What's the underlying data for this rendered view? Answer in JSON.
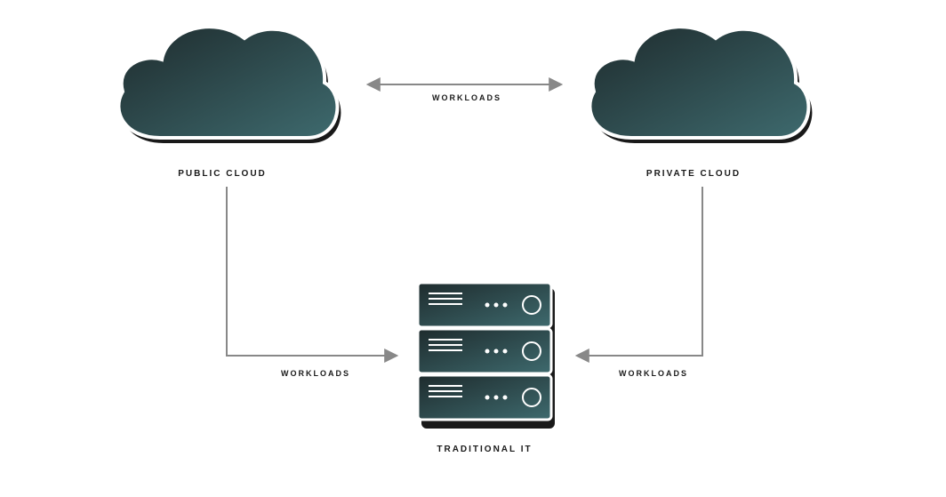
{
  "nodes": {
    "public_cloud": {
      "label": "PUBLIC CLOUD"
    },
    "private_cloud": {
      "label": "PRIVATE CLOUD"
    },
    "traditional_it": {
      "label": "TRADITIONAL IT"
    }
  },
  "arrows": {
    "top": {
      "label": "WORKLOADS"
    },
    "left": {
      "label": "WORKLOADS"
    },
    "right": {
      "label": "WORKLOADS"
    }
  },
  "colors": {
    "fill_dark": "#1e2b2d",
    "fill_light": "#3e6a6e",
    "outline": "#ffffff",
    "shadow": "#000000",
    "arrow": "#888888"
  }
}
